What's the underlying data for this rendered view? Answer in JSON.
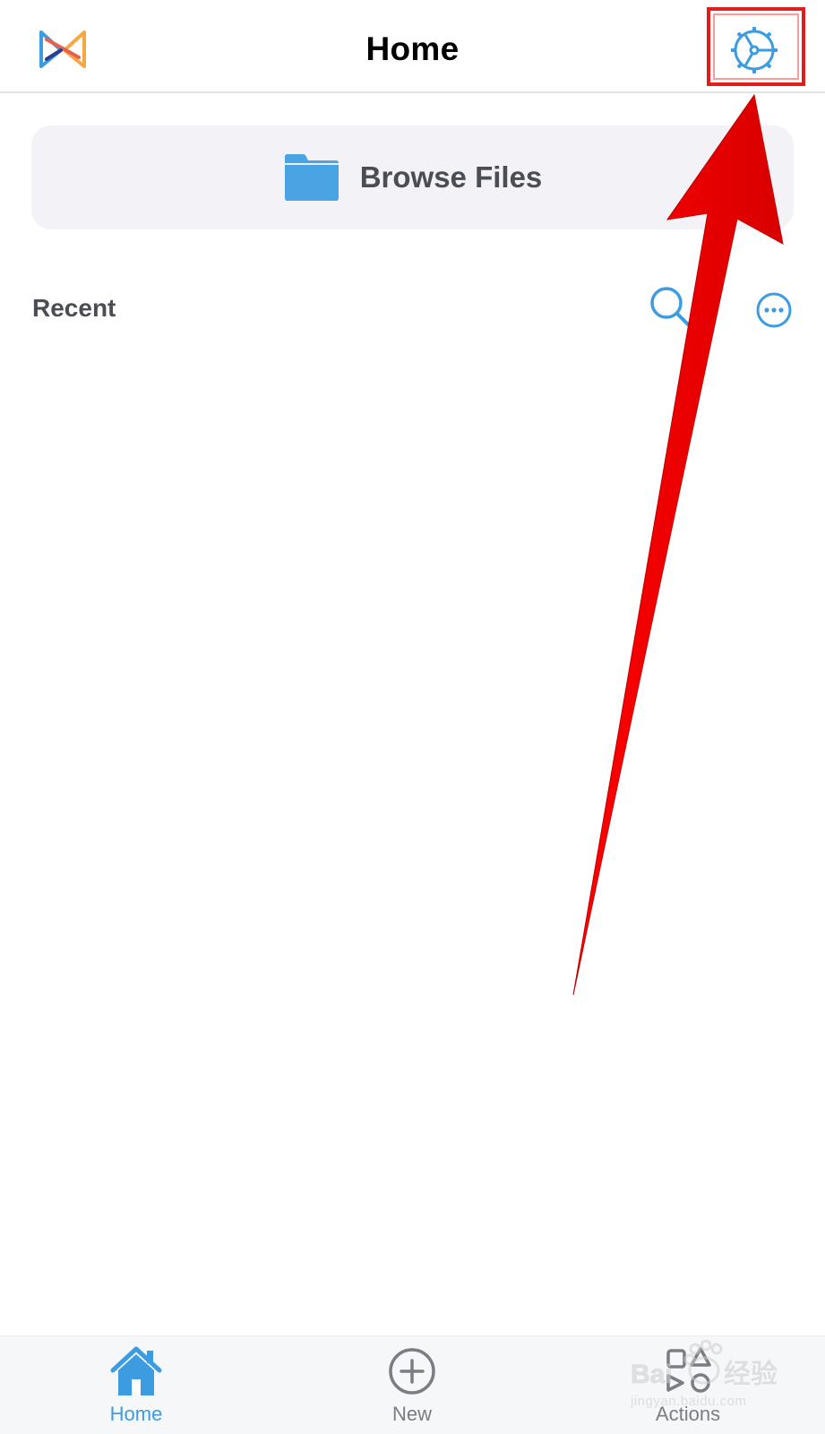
{
  "header": {
    "title": "Home",
    "logo_icon": "xodo-logo-icon",
    "settings_icon": "gear-icon"
  },
  "browse": {
    "label": "Browse Files",
    "icon": "folder-icon"
  },
  "recent": {
    "label": "Recent",
    "search_icon": "search-icon",
    "more_icon": "more-icon"
  },
  "tab_bar": {
    "tabs": [
      {
        "label": "Home",
        "icon": "home-icon",
        "active": true
      },
      {
        "label": "New",
        "icon": "plus-circle-icon",
        "active": false
      },
      {
        "label": "Actions",
        "icon": "actions-icon",
        "active": false
      }
    ]
  },
  "annotation": {
    "highlight": "settings-button",
    "arrow_color": "#ff0000"
  },
  "colors": {
    "accent": "#3d9be0",
    "text_dark": "#4a4d54",
    "highlight_red": "#e41c1c"
  },
  "watermark": {
    "text": "jingyan.baidu.com"
  }
}
